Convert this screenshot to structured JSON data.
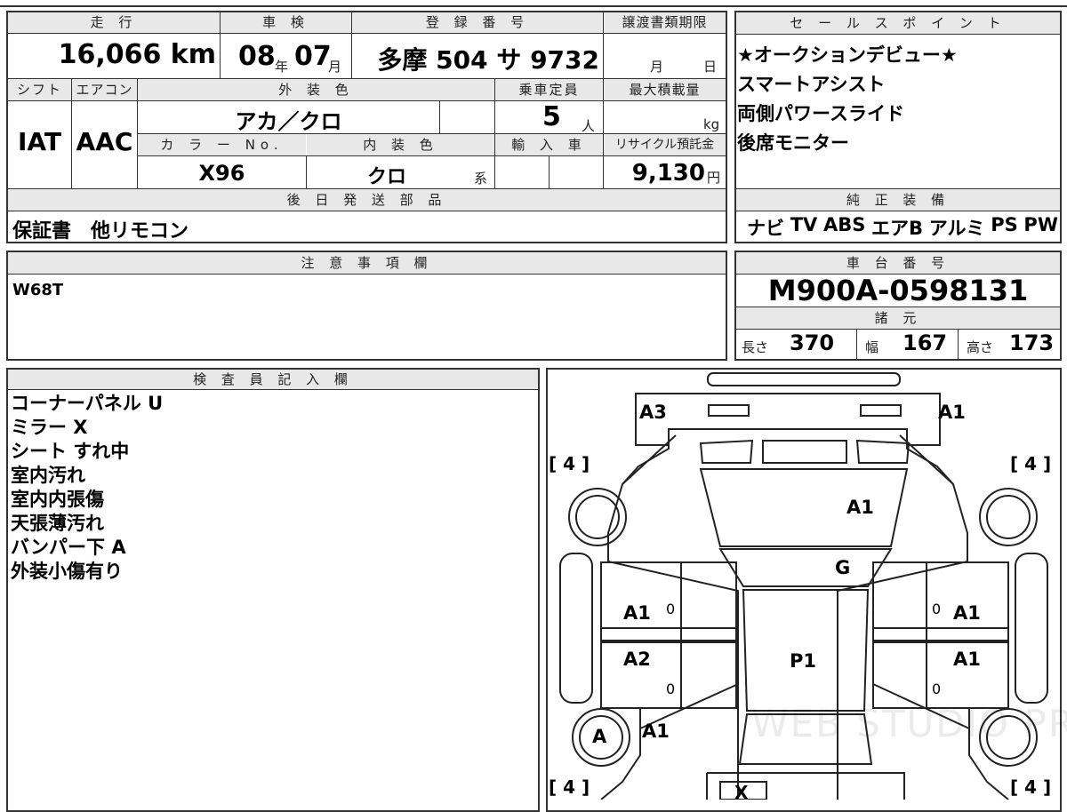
{
  "top_sheet": {
    "mileage_header": "走 行",
    "mileage_value": "16,066 km",
    "shaken_header": "車 検",
    "shaken_year": "08",
    "shaken_year_unit": "年",
    "shaken_month": "07",
    "shaken_month_unit": "月",
    "registration_header": "登 録 番 号",
    "registration_value": "多摩 504 サ 9732",
    "transfer_header": "譲渡書類期限",
    "transfer_month_unit": "月",
    "transfer_day_unit": "日",
    "shift_header": "シフト",
    "shift_value": "IAT",
    "ac_header": "エアコン",
    "ac_value": "AAC",
    "exterior_header": "外 装 色",
    "exterior_value": "アカ／クロ",
    "capacity_header": "乗車定員",
    "capacity_value": "5",
    "capacity_unit": "人",
    "maxload_header": "最大積載量",
    "maxload_unit": "kg",
    "color_no_header": "カ ラ ー No.",
    "color_no_value": "X96",
    "interior_header": "内 装 色",
    "interior_value": "クロ",
    "interior_unit": "系",
    "import_header": "輸 入 車",
    "recycle_header": "リサイクル預託金",
    "recycle_value": "9,130",
    "recycle_unit": "円",
    "later_parts_header": "後 日 発 送 部 品",
    "later_parts_value": "保証書　他リモコン"
  },
  "sales_points": {
    "header": "セ ー ル ス ポ イ ン ト",
    "items": [
      "★オークションデビュー★",
      "スマートアシスト",
      "両側パワースライド",
      "後席モニター"
    ]
  },
  "genuine_equipment": {
    "header": "純 正 装 備",
    "items": [
      "ナビ",
      "TV",
      "ABS",
      "エアB",
      "アルミ",
      "PS",
      "PW"
    ]
  },
  "notes": {
    "header": "注 意 事 項 欄",
    "value": "W68T"
  },
  "chassis": {
    "header": "車 台 番 号",
    "value": "M900A-0598131",
    "specs_header": "諸 元",
    "length_label": "長さ",
    "length_value": "370",
    "width_label": "幅",
    "width_value": "167",
    "height_label": "高さ",
    "height_value": "173"
  },
  "inspector": {
    "header": "検 査 員 記 入 欄",
    "lines": [
      "コーナーパネル U",
      "ミラー X",
      "シート すれ中",
      "室内汚れ",
      "室内内張傷",
      "天張薄汚れ",
      "バンパー下 A",
      "外装小傷有り"
    ]
  },
  "diagram": {
    "tire_tl": "[ 4 ]",
    "tire_tr": "[ 4 ]",
    "tire_bl": "[ 4 ]",
    "tire_br": "[ 4 ]",
    "front_left": "A3",
    "front_right": "A1",
    "hood": "A1",
    "windshield": "G",
    "left_front_door": "A1",
    "left_rear_door": "A2",
    "right_front_door": "A1",
    "right_rear_door": "A1",
    "roof": "P1",
    "left_rear_wheel": "A",
    "left_rear_quarter": "A1",
    "rear": "X",
    "door_mark_1": "0",
    "door_mark_2": "0",
    "door_mark_3": "0",
    "door_mark_4": "0",
    "watermark": "WEB STUDIO PRO"
  }
}
